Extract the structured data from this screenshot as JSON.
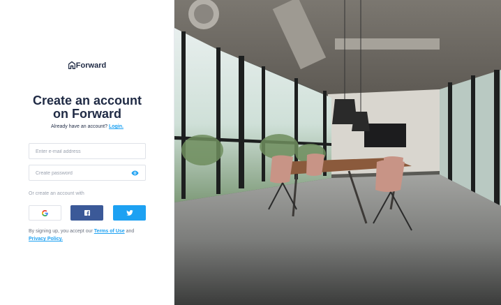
{
  "brand": {
    "name": "Forward",
    "logo_icon": "house-logo-icon"
  },
  "signup": {
    "title_line1": "Create an account",
    "title_line2": "on Forward",
    "have_account_text": "Already have an account?",
    "login_link": "Login.",
    "email_placeholder": "Enter e-mail address",
    "password_placeholder": "Create password",
    "password_toggle_icon": "eye-icon",
    "or_text": "Or create an account with",
    "social": [
      {
        "name": "Google",
        "icon": "google-icon",
        "color": "#ffffff"
      },
      {
        "name": "Facebook",
        "icon": "facebook-icon",
        "color": "#3b5998"
      },
      {
        "name": "Twitter",
        "icon": "twitter-icon",
        "color": "#1da1f2"
      }
    ],
    "terms_prefix": "By signing up, you accept our",
    "terms_link": "Terms of Use",
    "terms_and": "and",
    "privacy_link": "Privacy Policy."
  },
  "colors": {
    "accent": "#1da1f2",
    "text": "#1f2a44",
    "facebook": "#3b5998",
    "twitter": "#1da1f2"
  },
  "hero": {
    "image": "office-meeting-room-photo"
  }
}
